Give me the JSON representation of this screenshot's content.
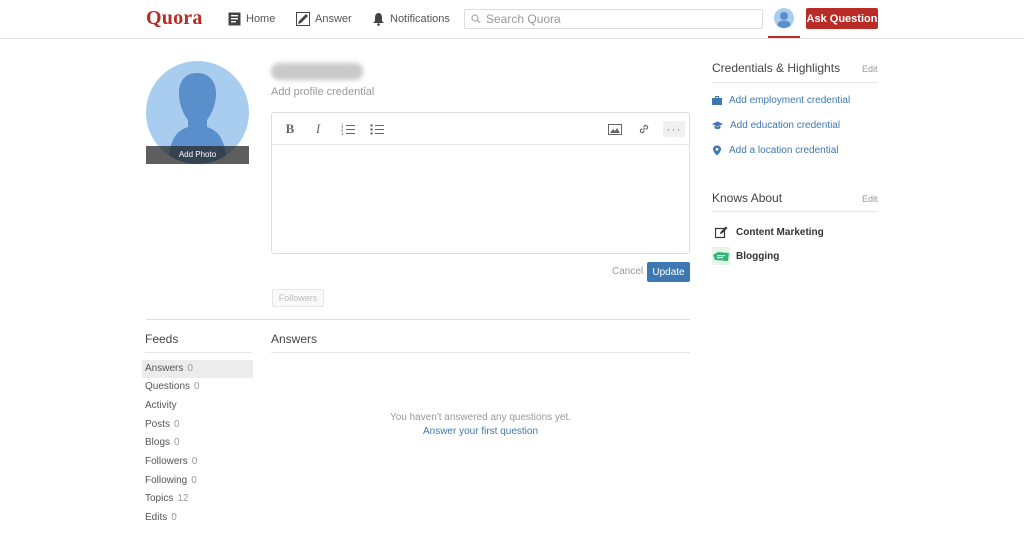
{
  "header": {
    "logo": "Quora",
    "nav": [
      {
        "label": "Home",
        "icon": "home-icon"
      },
      {
        "label": "Answer",
        "icon": "pencil-icon"
      },
      {
        "label": "Notifications",
        "icon": "bell-icon"
      }
    ],
    "search_placeholder": "Search Quora",
    "ask_button": "Ask Question",
    "accent_color": "#b92b27"
  },
  "profile": {
    "add_photo_label": "Add Photo",
    "add_credential": "Add profile credential",
    "cancel_label": "Cancel",
    "update_label": "Update",
    "followers_button": "Followers"
  },
  "editor": {
    "toolbar": [
      "bold-icon",
      "italic-icon",
      "numbered-list-icon",
      "bulleted-list-icon",
      "image-icon",
      "link-icon",
      "more-icon"
    ]
  },
  "feeds": {
    "title": "Feeds",
    "items": [
      {
        "label": "Answers",
        "count": "0",
        "active": true
      },
      {
        "label": "Questions",
        "count": "0"
      },
      {
        "label": "Activity",
        "count": ""
      },
      {
        "label": "Posts",
        "count": "0"
      },
      {
        "label": "Blogs",
        "count": "0"
      },
      {
        "label": "Followers",
        "count": "0"
      },
      {
        "label": "Following",
        "count": "0"
      },
      {
        "label": "Topics",
        "count": "12"
      },
      {
        "label": "Edits",
        "count": "0"
      }
    ]
  },
  "answers": {
    "title": "Answers",
    "empty_message": "You haven't answered any questions yet.",
    "first_question_link": "Answer your first question"
  },
  "credentials": {
    "title": "Credentials & Highlights",
    "edit_label": "Edit",
    "items": [
      {
        "label": "Add employment credential",
        "icon": "briefcase-icon"
      },
      {
        "label": "Add education credential",
        "icon": "graduation-cap-icon"
      },
      {
        "label": "Add a location credential",
        "icon": "location-pin-icon"
      }
    ]
  },
  "knows_about": {
    "title": "Knows About",
    "edit_label": "Edit",
    "topics": [
      {
        "label": "Content Marketing",
        "icon": "edit-square-icon"
      },
      {
        "label": "Blogging",
        "icon": "blogging-topic-icon"
      }
    ]
  },
  "colors": {
    "link_blue": "#3e78b2",
    "avatar_blue": "#a9cdee",
    "silhouette_blue": "#5b8fcb"
  }
}
